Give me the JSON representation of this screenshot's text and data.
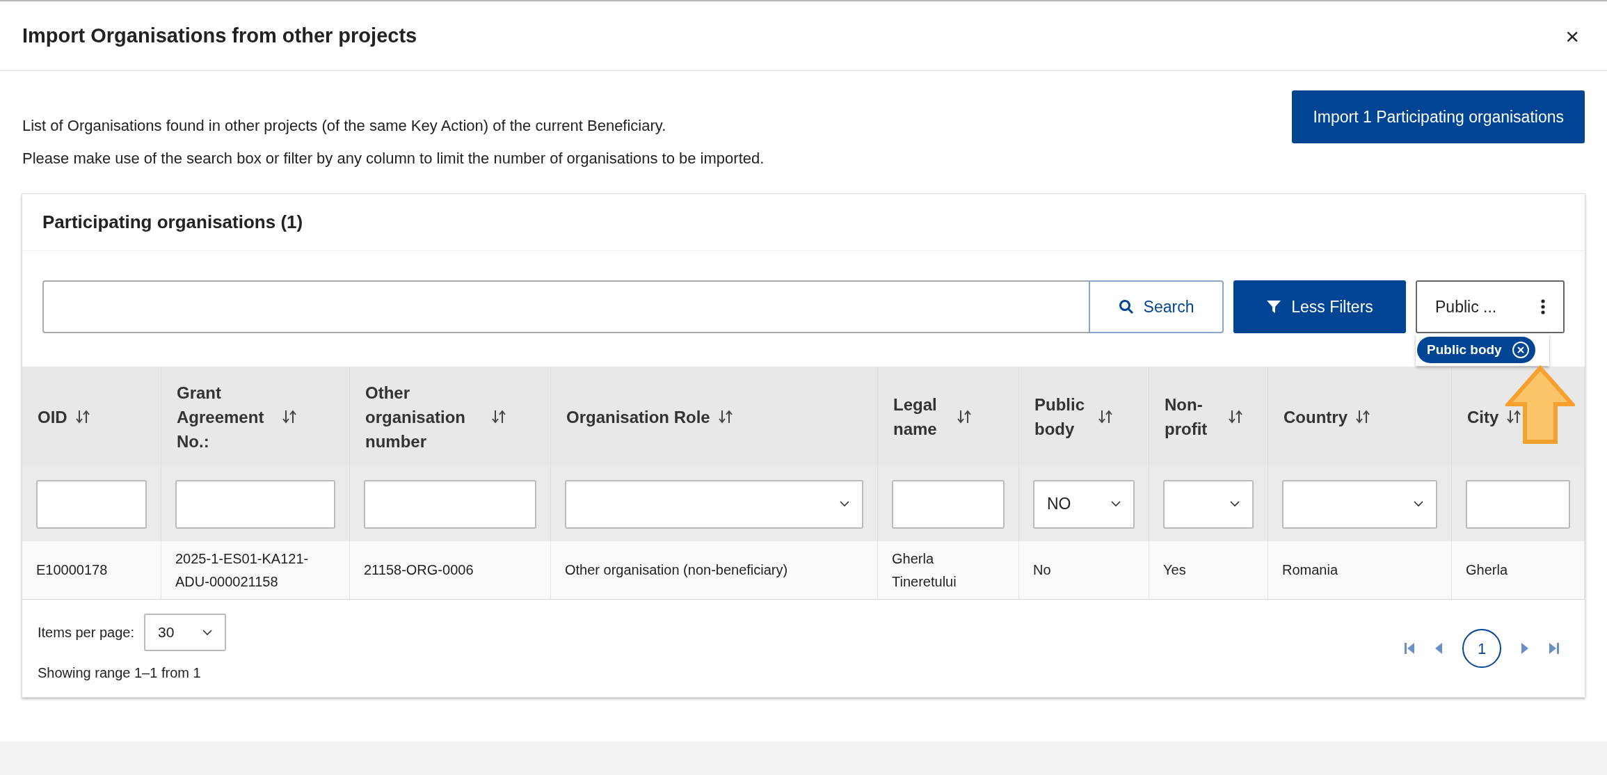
{
  "dialog": {
    "title": "Import Organisations from other projects",
    "close": "×"
  },
  "description": [
    "List of Organisations found in other projects (of the same Key Action) of the current Beneficiary.",
    "Please make use of the search box or filter by any column to limit the number of organisations to be imported."
  ],
  "import_button": "Import 1 Participating organisations",
  "panel": {
    "title": "Participating organisations (1)"
  },
  "search": {
    "button": "Search"
  },
  "filters_button": "Less Filters",
  "column_picker": {
    "label": "Public ..."
  },
  "active_filters": [
    {
      "label": "Public body"
    }
  ],
  "table": {
    "columns": [
      {
        "label": "OID",
        "kind": "text"
      },
      {
        "label": "Grant Agreement No.:",
        "kind": "text"
      },
      {
        "label": "Other organisation number",
        "kind": "text"
      },
      {
        "label": "Organisation Role",
        "kind": "select"
      },
      {
        "label": "Legal name",
        "kind": "text"
      },
      {
        "label": "Public body",
        "kind": "select",
        "value": "NO"
      },
      {
        "label": "Non-profit",
        "kind": "select"
      },
      {
        "label": "Country",
        "kind": "select"
      },
      {
        "label": "City",
        "kind": "text"
      }
    ],
    "rows": [
      [
        "E10000178",
        "2025-1-ES01-KA121-ADU-000021158",
        "21158-ORG-0006",
        "Other organisation (non-beneficiary)",
        "Gherla Tineretului",
        "No",
        "Yes",
        "Romania",
        "Gherla"
      ]
    ]
  },
  "pagination": {
    "items_per_page_label": "Items per page:",
    "items_per_page": "30",
    "range": "Showing range 1–1 from 1",
    "pages": [
      {
        "label": "1",
        "selected": true
      }
    ]
  }
}
